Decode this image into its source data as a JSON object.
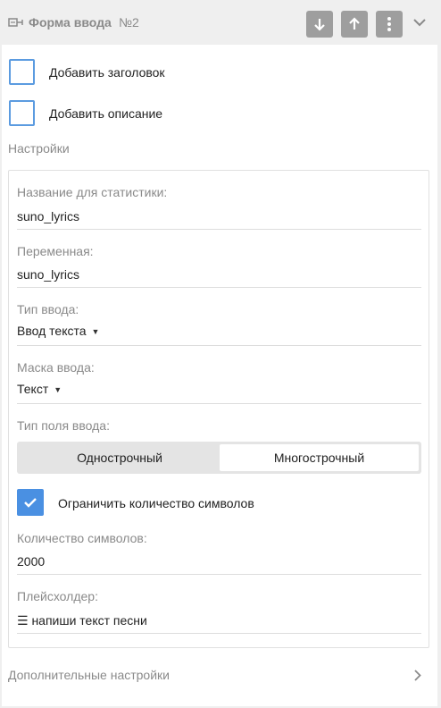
{
  "header": {
    "title": "Форма ввода",
    "number": "№2",
    "icons": [
      "block-icon",
      "arrow-down-icon",
      "arrow-up-icon",
      "more-vertical-icon",
      "chevron-down-icon"
    ]
  },
  "options": {
    "add_title_label": "Добавить заголовок",
    "add_description_label": "Добавить описание",
    "add_title_checked": false,
    "add_description_checked": false
  },
  "settings": {
    "section_label": "Настройки",
    "stat_name": {
      "label": "Название для статистики:",
      "value": "suno_lyrics"
    },
    "variable": {
      "label": "Переменная:",
      "value": "suno_lyrics"
    },
    "input_type": {
      "label": "Тип ввода:",
      "value": "Ввод текста",
      "caret": "▼"
    },
    "input_mask": {
      "label": "Маска ввода:",
      "value": "Текст",
      "caret": "▼"
    },
    "field_type": {
      "label": "Тип поля ввода:",
      "options": [
        "Однострочный",
        "Многострочный"
      ],
      "selected": "Многострочный"
    },
    "limit_chars": {
      "label": "Ограничить количество символов",
      "checked": true
    },
    "char_count": {
      "label": "Количество символов:",
      "value": "2000"
    },
    "placeholder": {
      "label": "Плейсхолдер:",
      "value": "☰ напиши текст песни"
    }
  },
  "advanced": {
    "label": "Дополнительные настройки"
  },
  "colors": {
    "accent": "#4a90e2",
    "header_button": "#9e9e9e",
    "muted_text": "#8a8a8a"
  }
}
